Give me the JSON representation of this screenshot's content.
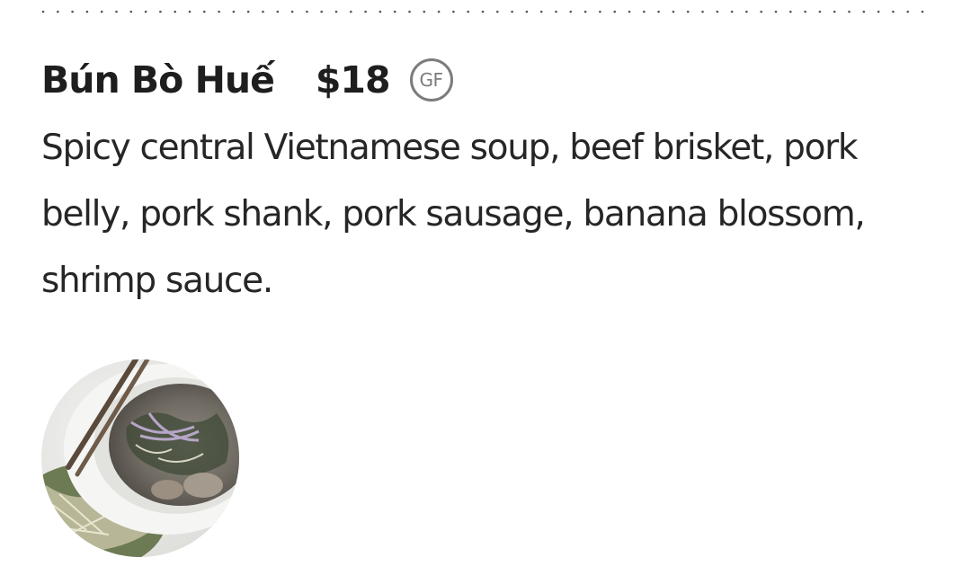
{
  "menu_item": {
    "name": "Bún Bò Huế",
    "price": "$18",
    "dietary_badge": "GF",
    "description": "Spicy central Vietnamese soup, beef brisket, pork belly, pork shank, pork sausage, banana blossom, shrimp sauce.",
    "photo_icon": "soup-bowl-photo"
  },
  "colors": {
    "text": "#1e1e1e",
    "badge": "#7c7c7c",
    "divider": "#555555",
    "background": "#ffffff"
  }
}
